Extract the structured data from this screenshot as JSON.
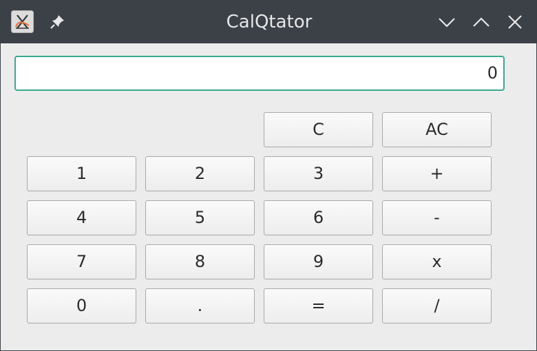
{
  "window": {
    "title": "CalQtator"
  },
  "display": {
    "value": "0"
  },
  "keys": {
    "c": "C",
    "ac": "AC",
    "k1": "1",
    "k2": "2",
    "k3": "3",
    "plus": "+",
    "k4": "4",
    "k5": "5",
    "k6": "6",
    "minus": "-",
    "k7": "7",
    "k8": "8",
    "k9": "9",
    "times": "x",
    "k0": "0",
    "dot": ".",
    "equals": "=",
    "divide": "/"
  },
  "icons": {
    "app": "app-icon",
    "pin": "pin-icon",
    "minimize": "minimize-icon",
    "maximize": "maximize-icon",
    "close": "close-icon"
  },
  "colors": {
    "titlebar": "#3c4147",
    "focus_border": "#3aa890",
    "window_bg": "#ececec"
  }
}
